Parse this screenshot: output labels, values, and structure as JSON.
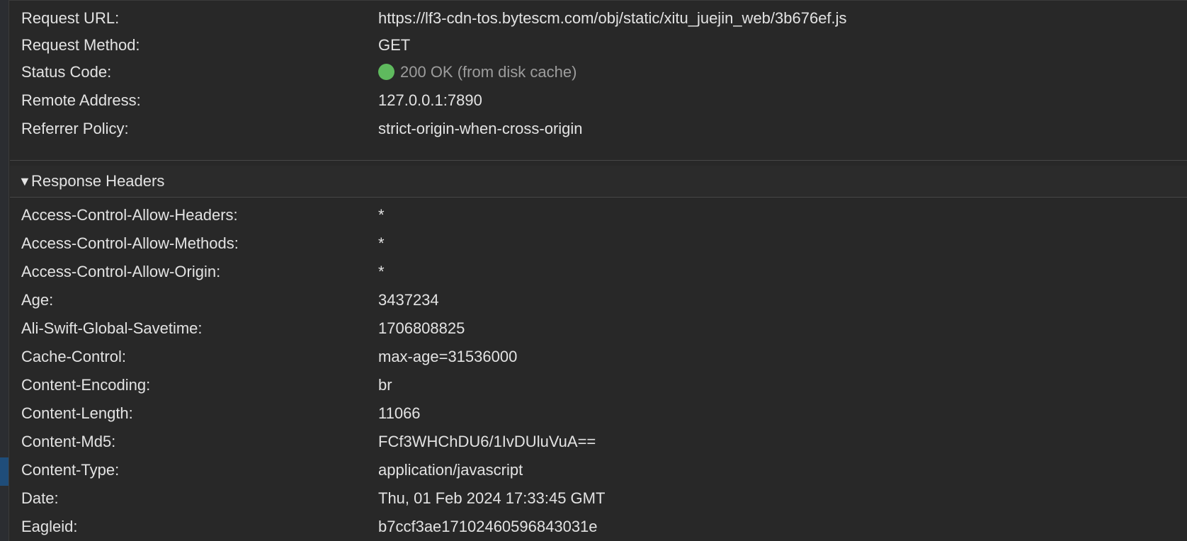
{
  "general": [
    {
      "key": "Request URL:",
      "value": "https://lf3-cdn-tos.bytescm.com/obj/static/xitu_juejin_web/3b676ef.js"
    },
    {
      "key": "Request Method:",
      "value": "GET"
    },
    {
      "key": "Status Code:",
      "value": "200 OK (from disk cache)"
    },
    {
      "key": "Remote Address:",
      "value": "127.0.0.1:7890"
    },
    {
      "key": "Referrer Policy:",
      "value": "strict-origin-when-cross-origin"
    }
  ],
  "response_headers": {
    "title": "Response Headers",
    "toggle_icon": "▼",
    "items": [
      {
        "key": "Access-Control-Allow-Headers:",
        "value": "*"
      },
      {
        "key": "Access-Control-Allow-Methods:",
        "value": "*"
      },
      {
        "key": "Access-Control-Allow-Origin:",
        "value": "*"
      },
      {
        "key": "Age:",
        "value": "3437234"
      },
      {
        "key": "Ali-Swift-Global-Savetime:",
        "value": "1706808825"
      },
      {
        "key": "Cache-Control:",
        "value": "max-age=31536000"
      },
      {
        "key": "Content-Encoding:",
        "value": "br"
      },
      {
        "key": "Content-Length:",
        "value": "11066"
      },
      {
        "key": "Content-Md5:",
        "value": "FCf3WHChDU6/1IvDUluVuA=="
      },
      {
        "key": "Content-Type:",
        "value": "application/javascript"
      },
      {
        "key": "Date:",
        "value": "Thu, 01 Feb 2024 17:33:45 GMT"
      },
      {
        "key": "Eagleid:",
        "value": "b7ccf3ae17102460596843031e"
      }
    ]
  },
  "colors": {
    "background": "#282828",
    "text": "#e3e3e3",
    "status_ok_dot": "#5fba5e",
    "status_text": "#9d9d9d",
    "selection": "#1f4d7a"
  }
}
